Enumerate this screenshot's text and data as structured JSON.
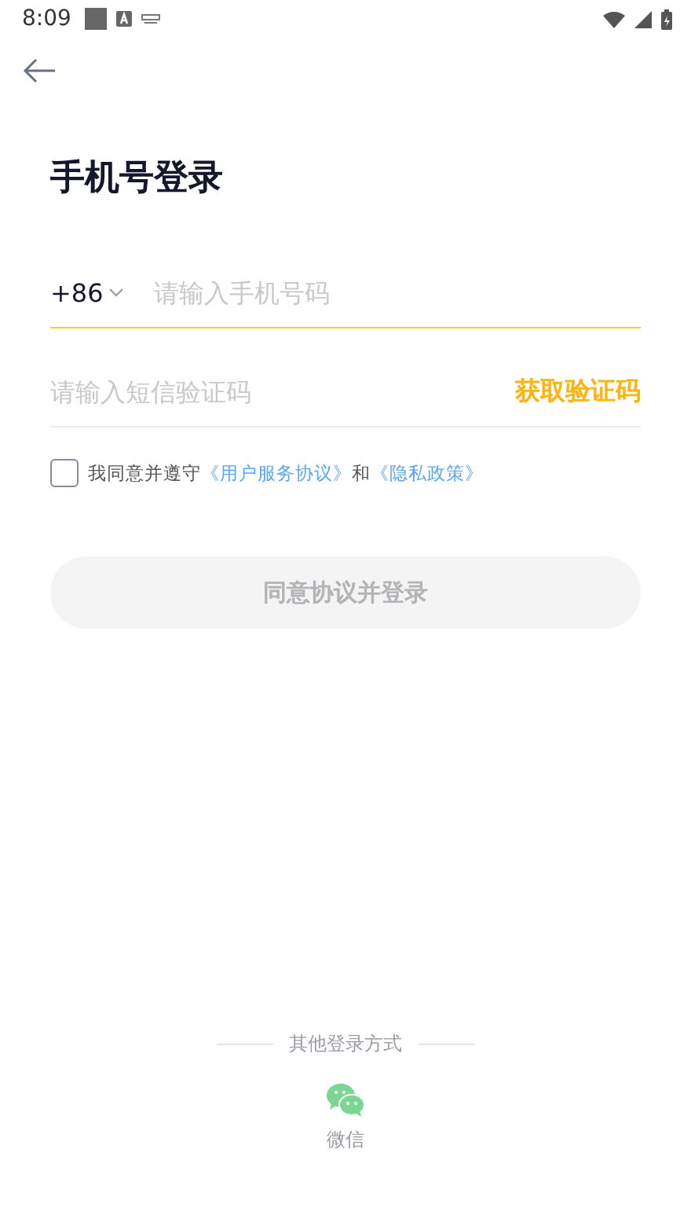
{
  "status_bar": {
    "time": "8:09"
  },
  "title": "手机号登录",
  "phone": {
    "country_code": "+86",
    "placeholder": "请输入手机号码",
    "focused": true
  },
  "code": {
    "placeholder": "请输入短信验证码",
    "action": "获取验证码"
  },
  "agreement": {
    "checked": false,
    "prefix": "我同意并遵守",
    "link_1": "《用户服务协议》",
    "joiner": "和",
    "link_2": "《隐私政策》"
  },
  "login_button": {
    "label": "同意协议并登录",
    "disabled": true
  },
  "other_login": {
    "heading": "其他登录方式",
    "options": [
      {
        "kind": "wechat",
        "label": "微信"
      }
    ]
  }
}
